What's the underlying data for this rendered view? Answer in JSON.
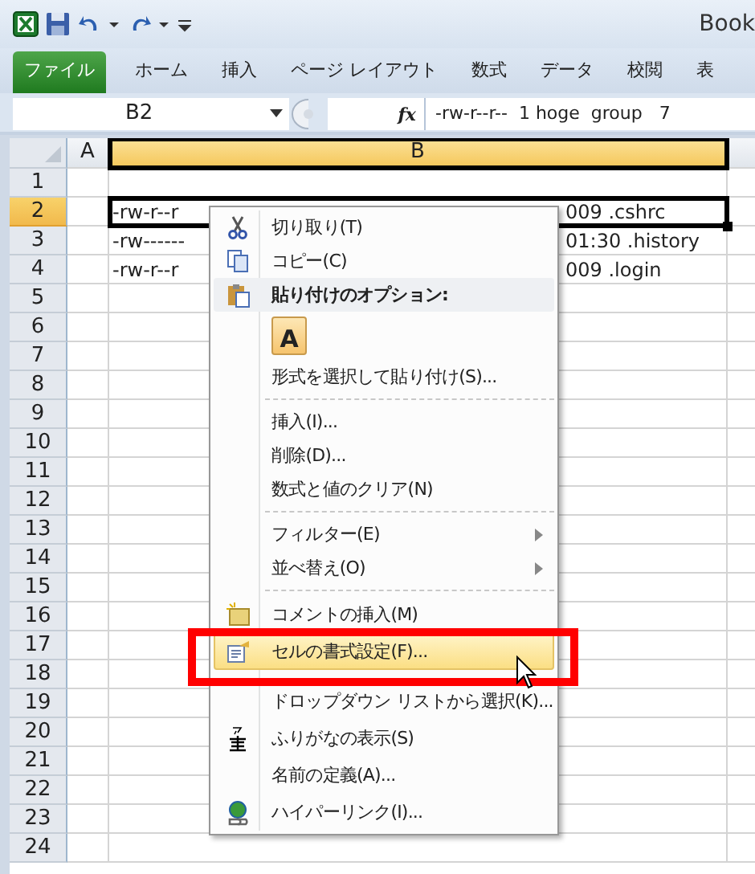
{
  "window": {
    "title": "Book"
  },
  "ribbon_tabs": [
    {
      "label": "ファイル",
      "kind": "file",
      "selected": false
    },
    {
      "label": "ホーム",
      "kind": "tab",
      "selected": false
    },
    {
      "label": "挿入",
      "kind": "tab",
      "selected": false
    },
    {
      "label": "ページ レイアウト",
      "kind": "tab",
      "selected": false
    },
    {
      "label": "数式",
      "kind": "tab",
      "selected": false
    },
    {
      "label": "データ",
      "kind": "tab",
      "selected": false
    },
    {
      "label": "校閲",
      "kind": "tab",
      "selected": false
    },
    {
      "label": "表",
      "kind": "tab",
      "selected": false
    }
  ],
  "formula_bar": {
    "name_box": "B2",
    "function_label": "fx",
    "formula": "-rw-r--r--  1 hoge  group   7"
  },
  "columns": [
    {
      "label": "A",
      "selected": false
    },
    {
      "label": "B",
      "selected": true
    }
  ],
  "rows": [
    {
      "label": "1",
      "selected": false
    },
    {
      "label": "2",
      "selected": true,
      "cell_left": "-rw-r--r",
      "cell_right": "009 .cshrc"
    },
    {
      "label": "3",
      "selected": false,
      "cell_left": "-rw------",
      "cell_right": "01:30 .history"
    },
    {
      "label": "4",
      "selected": false,
      "cell_left": "-rw-r--r",
      "cell_right": "009 .login"
    },
    {
      "label": "5",
      "selected": false
    },
    {
      "label": "6",
      "selected": false
    },
    {
      "label": "7",
      "selected": false
    },
    {
      "label": "8",
      "selected": false
    },
    {
      "label": "9",
      "selected": false
    },
    {
      "label": "10",
      "selected": false
    },
    {
      "label": "11",
      "selected": false
    },
    {
      "label": "12",
      "selected": false
    },
    {
      "label": "13",
      "selected": false
    },
    {
      "label": "14",
      "selected": false
    },
    {
      "label": "15",
      "selected": false
    },
    {
      "label": "16",
      "selected": false
    },
    {
      "label": "17",
      "selected": false
    },
    {
      "label": "18",
      "selected": false
    },
    {
      "label": "19",
      "selected": false
    },
    {
      "label": "20",
      "selected": false
    },
    {
      "label": "21",
      "selected": false
    },
    {
      "label": "22",
      "selected": false
    },
    {
      "label": "23",
      "selected": false
    },
    {
      "label": "24",
      "selected": false
    }
  ],
  "context_menu": {
    "items": [
      {
        "kind": "command",
        "label": "切り取り(T)",
        "highlighted": false,
        "submenu": false
      },
      {
        "kind": "command",
        "label": "コピー(C)",
        "highlighted": false,
        "submenu": false
      },
      {
        "kind": "header",
        "label": "貼り付けのオプション:"
      },
      {
        "kind": "paste",
        "label": "A"
      },
      {
        "kind": "command",
        "label": "形式を選択して貼り付け(S)...",
        "highlighted": false,
        "submenu": false
      },
      {
        "kind": "separator"
      },
      {
        "kind": "command",
        "label": "挿入(I)...",
        "highlighted": false,
        "submenu": false
      },
      {
        "kind": "command",
        "label": "削除(D)...",
        "highlighted": false,
        "submenu": false
      },
      {
        "kind": "command",
        "label": "数式と値のクリア(N)",
        "highlighted": false,
        "submenu": false
      },
      {
        "kind": "separator"
      },
      {
        "kind": "command",
        "label": "フィルター(E)",
        "highlighted": false,
        "submenu": true
      },
      {
        "kind": "command",
        "label": "並べ替え(O)",
        "highlighted": false,
        "submenu": true
      },
      {
        "kind": "separator"
      },
      {
        "kind": "command",
        "label": "コメントの挿入(M)",
        "highlighted": false,
        "submenu": false
      },
      {
        "kind": "command",
        "label": "セルの書式設定(F)...",
        "highlighted": true,
        "submenu": false
      },
      {
        "kind": "command",
        "label": "ドロップダウン リストから選択(K)...",
        "highlighted": false,
        "submenu": false
      },
      {
        "kind": "command",
        "label": "ふりがなの表示(S)",
        "highlighted": false,
        "submenu": false
      },
      {
        "kind": "command",
        "label": "名前の定義(A)...",
        "highlighted": false,
        "submenu": false
      },
      {
        "kind": "command",
        "label": "ハイパーリンク(I)...",
        "highlighted": false,
        "submenu": false
      }
    ]
  }
}
